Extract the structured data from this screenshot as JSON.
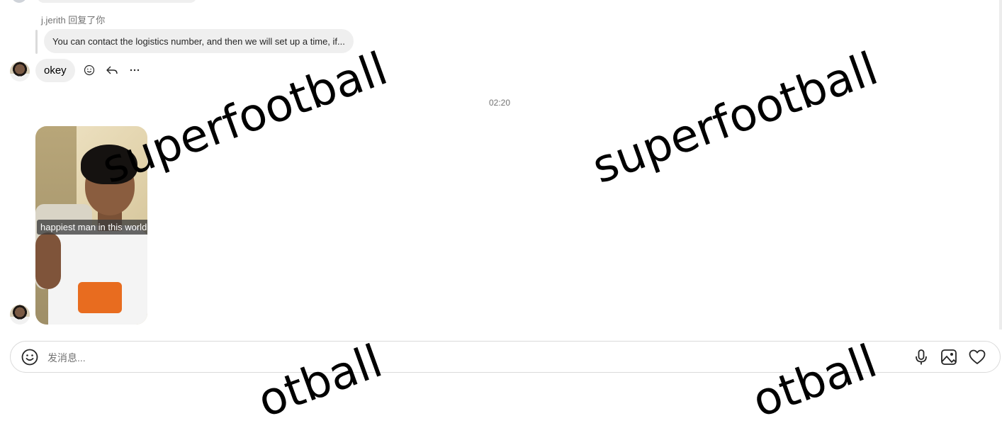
{
  "thread": {
    "reply_header": "j.jerith 回复了你",
    "reply_quote": "You can contact the logistics number, and then we will set up a time, if...",
    "message_text": "okey",
    "timestamp": "02:20",
    "photo_caption": "happiest man in this world"
  },
  "watermark": {
    "text_full": "superfootball",
    "text_partial": "otball"
  },
  "composer": {
    "placeholder": "发消息..."
  },
  "icons": {
    "react": "smiley-icon",
    "reply": "reply-arrow-icon",
    "more": "more-dots-icon",
    "emoji": "emoji-icon",
    "mic": "microphone-icon",
    "image": "image-icon",
    "like": "heart-icon"
  }
}
